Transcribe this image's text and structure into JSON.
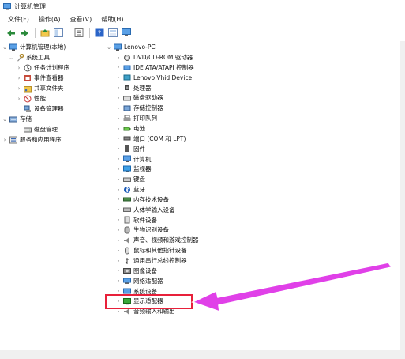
{
  "window": {
    "title": "计算机管理"
  },
  "menu": [
    "文件(F)",
    "操作(A)",
    "查看(V)",
    "帮助(H)"
  ],
  "toolbar": {
    "buttons": [
      "back-icon",
      "forward-icon",
      "up-folder-icon",
      "show-tree-icon",
      "properties-icon",
      "help-icon",
      "scope-icon",
      "monitor-icon"
    ]
  },
  "left_tree": {
    "root": "计算机管理(本地)",
    "system_tools": "系统工具",
    "task_scheduler": "任务计划程序",
    "event_viewer": "事件查看器",
    "shared_folders": "共享文件夹",
    "performance": "性能",
    "device_manager": "设备管理器",
    "storage": "存储",
    "disk_management": "磁盘管理",
    "services_apps": "服务和应用程序"
  },
  "device_tree": {
    "root": "Lenovo-PC",
    "categories": [
      "DVD/CD-ROM 驱动器",
      "IDE ATA/ATAPI 控制器",
      "Lenovo Vhid Device",
      "处理器",
      "磁盘驱动器",
      "存储控制器",
      "打印队列",
      "电池",
      "端口 (COM 和 LPT)",
      "固件",
      "计算机",
      "监视器",
      "键盘",
      "蓝牙",
      "内存技术设备",
      "人体学输入设备",
      "软件设备",
      "生物识别设备",
      "声音、视频和游戏控制器",
      "鼠标和其他指针设备",
      "通用串行总线控制器",
      "图像设备",
      "网络适配器",
      "系统设备",
      "显示适配器",
      "音频输入和输出"
    ],
    "highlighted": "显示适配器"
  },
  "colors": {
    "highlight_border": "#e8203a",
    "arrow": "#e040e8"
  }
}
